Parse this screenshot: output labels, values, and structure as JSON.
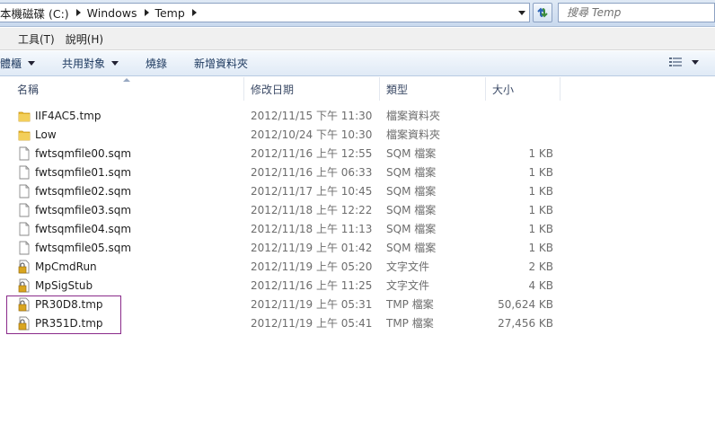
{
  "address": {
    "crumbs": [
      "本機磁碟 (C:)",
      "Windows",
      "Temp"
    ]
  },
  "search": {
    "placeholder": "搜尋 Temp"
  },
  "menu": {
    "items": [
      "工具(T)",
      "說明(H)"
    ]
  },
  "commands": {
    "organize": "體櫃",
    "share": "共用對象",
    "burn": "燒錄",
    "new_folder": "新增資料夾"
  },
  "columns": {
    "name": "名稱",
    "date": "修改日期",
    "type": "類型",
    "size": "大小"
  },
  "files": [
    {
      "name": "IIF4AC5.tmp",
      "date": "2012/11/15 下午 11:30",
      "type": "檔案資料夾",
      "size": "",
      "icon": "folder-icon"
    },
    {
      "name": "Low",
      "date": "2012/10/24 下午 10:30",
      "type": "檔案資料夾",
      "size": "",
      "icon": "folder-icon"
    },
    {
      "name": "fwtsqmfile00.sqm",
      "date": "2012/11/16 上午 12:55",
      "type": "SQM 檔案",
      "size": "1 KB",
      "icon": "file-icon"
    },
    {
      "name": "fwtsqmfile01.sqm",
      "date": "2012/11/16 上午 06:33",
      "type": "SQM 檔案",
      "size": "1 KB",
      "icon": "file-icon"
    },
    {
      "name": "fwtsqmfile02.sqm",
      "date": "2012/11/17 上午 10:45",
      "type": "SQM 檔案",
      "size": "1 KB",
      "icon": "file-icon"
    },
    {
      "name": "fwtsqmfile03.sqm",
      "date": "2012/11/18 上午 12:22",
      "type": "SQM 檔案",
      "size": "1 KB",
      "icon": "file-icon"
    },
    {
      "name": "fwtsqmfile04.sqm",
      "date": "2012/11/18 上午 11:13",
      "type": "SQM 檔案",
      "size": "1 KB",
      "icon": "file-icon"
    },
    {
      "name": "fwtsqmfile05.sqm",
      "date": "2012/11/19 上午 01:42",
      "type": "SQM 檔案",
      "size": "1 KB",
      "icon": "file-icon"
    },
    {
      "name": "MpCmdRun",
      "date": "2012/11/19 上午 05:20",
      "type": "文字文件",
      "size": "2 KB",
      "icon": "locked-file-icon"
    },
    {
      "name": "MpSigStub",
      "date": "2012/11/16 上午 11:25",
      "type": "文字文件",
      "size": "4 KB",
      "icon": "locked-file-icon"
    },
    {
      "name": "PR30D8.tmp",
      "date": "2012/11/19 上午 05:31",
      "type": "TMP 檔案",
      "size": "50,624 KB",
      "icon": "locked-file-icon"
    },
    {
      "name": "PR351D.tmp",
      "date": "2012/11/19 上午 05:41",
      "type": "TMP 檔案",
      "size": "27,456 KB",
      "icon": "locked-file-icon"
    }
  ],
  "colors": {
    "highlight_border": "#8a2a8a",
    "folder": "#e8b930"
  }
}
